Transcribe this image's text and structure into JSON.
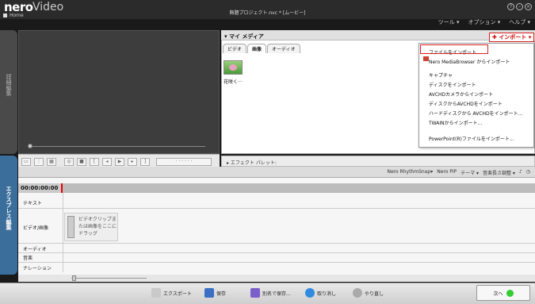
{
  "app": {
    "logo": "nero",
    "name": "Video",
    "home": "Home",
    "document_title": "無題プロジェクト.nvc * [ムービー]"
  },
  "menus": [
    "ツール ▾",
    "オプション ▾",
    "ヘルプ ▾"
  ],
  "left_tabs": {
    "edit": "詳細編集",
    "express": "エクスプレス編集"
  },
  "media": {
    "title": "▾ マイ メディア",
    "tabs": [
      "ビデオ",
      "画像",
      "オーディオ"
    ],
    "thumb_label": "花咲く···"
  },
  "import": {
    "button": "✚ インポート ▾",
    "items": [
      "ファイルをインポート...",
      "Nero MediaBrowser からインポート",
      "キャプチャ",
      "ディスクをインポート",
      "AVCHDカメラからインポート",
      "ディスクからAVCHDをインポート",
      "ハードディスクから AVCHDをインポート...",
      "TWAINからインポート...",
      "PowerPoint(R)ファイルをインポート..."
    ]
  },
  "effects": {
    "label": "▸ エフェクト パレット:"
  },
  "timeline_tools": [
    "Nero RhythmSnap▾",
    "Nero PiP",
    "テーマ ▾",
    "音楽長さ調整 ▾"
  ],
  "timeline": {
    "timecode": "00:00:00:00",
    "tracks": [
      "テキスト",
      "ビデオ/画像",
      "オーディオ",
      "音楽",
      "ナレーション"
    ],
    "dropzone": "ビデオクリップま\nたは画像をここに\nドラッグ"
  },
  "bottom": {
    "export": "エクスポート",
    "save": "保存",
    "save_as": "別名で保存...",
    "undo": "取り消し",
    "redo": "やり直し",
    "next": "次へ"
  },
  "colors": {
    "accent_red": "#d82020",
    "express_tab": "#3b6e9b"
  }
}
